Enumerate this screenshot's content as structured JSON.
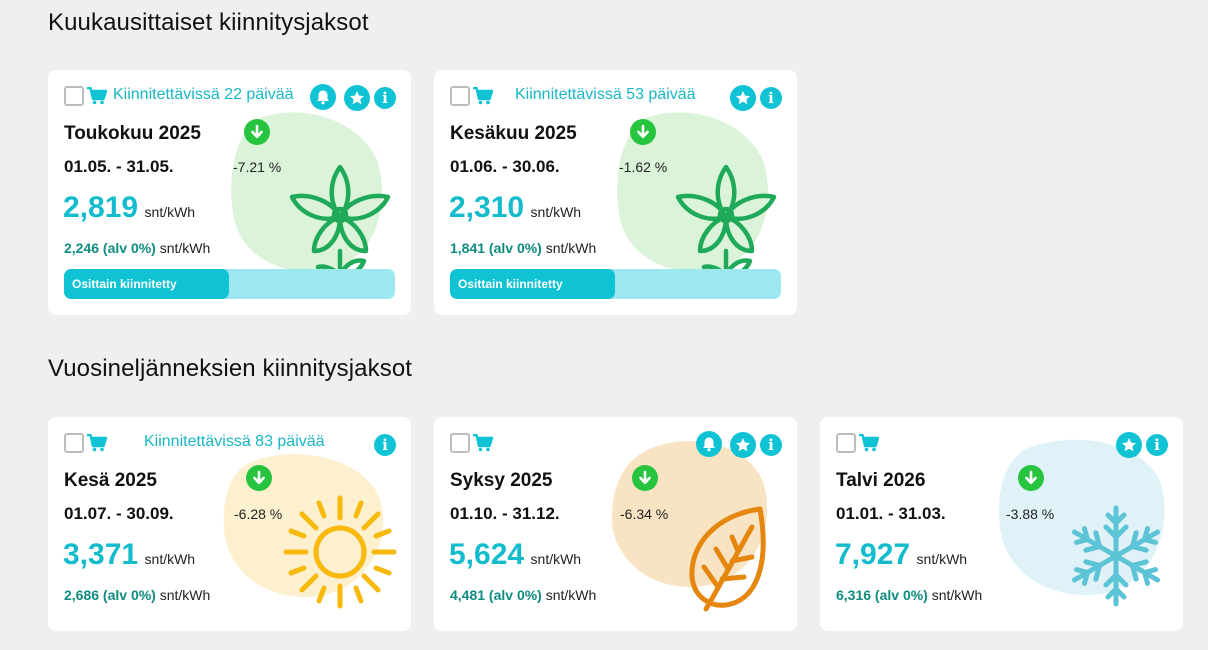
{
  "monthly": {
    "title": "Kuukausittaiset kiinnitysjaksot",
    "cards": [
      {
        "availability": "Kiinnitettävissä 22 päivää",
        "name": "Toukokuu 2025",
        "dates": "01.05. - 31.05.",
        "change": "-7.21 %",
        "price": "2,819",
        "unit": "snt/kWh",
        "vat_price": "2,246 (alv 0%)",
        "vat_unit": "snt/kWh",
        "status": "Osittain kiinnitetty",
        "fixed_fraction": 0.5,
        "icons": [
          "bell-icon",
          "star-icon",
          "info-icon"
        ],
        "art": "flower-icon"
      },
      {
        "availability": "Kiinnitettävissä 53 päivää",
        "name": "Kesäkuu 2025",
        "dates": "01.06. - 30.06.",
        "change": "-1.62 %",
        "price": "2,310",
        "unit": "snt/kWh",
        "vat_price": "1,841 (alv 0%)",
        "vat_unit": "snt/kWh",
        "status": "Osittain kiinnitetty",
        "fixed_fraction": 0.5,
        "icons": [
          "star-icon",
          "info-icon"
        ],
        "art": "flower-icon"
      }
    ]
  },
  "quarterly": {
    "title": "Vuosineljänneksien kiinnitysjaksot",
    "cards": [
      {
        "availability": "Kiinnitettävissä 83 päivää",
        "name": "Kesä 2025",
        "dates": "01.07. - 30.09.",
        "change": "-6.28 %",
        "price": "3,371",
        "unit": "snt/kWh",
        "vat_price": "2,686 (alv 0%)",
        "vat_unit": "snt/kWh",
        "icons": [
          "info-icon"
        ],
        "art": "sun-icon"
      },
      {
        "availability": "",
        "name": "Syksy 2025",
        "dates": "01.10. - 31.12.",
        "change": "-6.34 %",
        "price": "5,624",
        "unit": "snt/kWh",
        "vat_price": "4,481 (alv 0%)",
        "vat_unit": "snt/kWh",
        "icons": [
          "bell-icon",
          "star-icon",
          "info-icon"
        ],
        "art": "leaf-icon"
      },
      {
        "availability": "",
        "name": "Talvi 2026",
        "dates": "01.01. - 31.03.",
        "change": "-3.88 %",
        "price": "7,927",
        "unit": "snt/kWh",
        "vat_price": "6,316 (alv 0%)",
        "vat_unit": "snt/kWh",
        "icons": [
          "star-icon",
          "info-icon"
        ],
        "art": "snowflake-icon"
      }
    ]
  },
  "colors": {
    "accent": "#0fc3d4",
    "price": "#12bccc",
    "vat": "#0e8c80",
    "down": "#27c53f",
    "flower": "#1faa5a",
    "flower_blob": "#dbf3d9",
    "sun": "#f7b90a",
    "sun_blob": "#fcf0cf",
    "leaf": "#e5870e",
    "leaf_blob": "#f8e3c3",
    "snow": "#5bc4d6",
    "snow_blob": "#dff2f8"
  }
}
